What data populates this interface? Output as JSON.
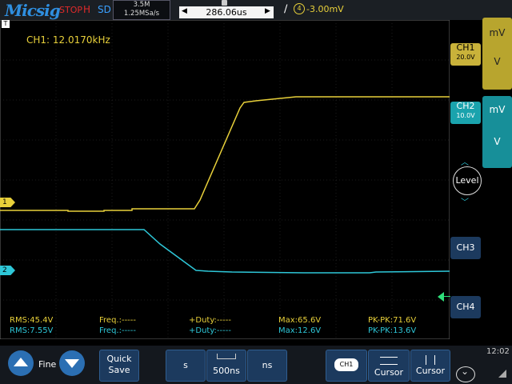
{
  "header": {
    "brand": "Micsig",
    "run_state": "STOP",
    "acq_mode": "H",
    "storage_mode": "SD",
    "memory_depth": "3.5M",
    "sample_rate": "1.25MSa/s",
    "time_position": "286.06us",
    "trigger_source": "4",
    "trigger_level": "-3.00mV"
  },
  "display": {
    "frequency_readout": "CH1: 12.0170kHz",
    "ch1_marker": "1",
    "ch2_marker": "2",
    "trigger_marker_label": "T"
  },
  "measurements": {
    "row1": {
      "rms": "RMS:45.4V",
      "freq": "Freq.:-----",
      "duty": "+Duty:-----",
      "max": "Max:65.6V",
      "pkpk": "PK-PK:71.6V"
    },
    "row2": {
      "rms": "RMS:7.55V",
      "freq": "Freq.:-----",
      "duty": "+Duty:-----",
      "max": "Max:12.6V",
      "pkpk": "PK-PK:13.6V"
    }
  },
  "channels": {
    "ch1": {
      "label": "CH1",
      "scale": "20.0V",
      "color": "#e8d03a"
    },
    "ch2": {
      "label": "CH2",
      "scale": "10.0V",
      "color": "#2ec7d8"
    },
    "ch3": {
      "label": "CH3"
    },
    "ch4": {
      "label": "CH4"
    }
  },
  "side_panels": {
    "ch1_unit_top": "mV",
    "ch1_unit_bottom": "V",
    "ch2_unit_top": "mV",
    "ch2_unit_bottom": "V",
    "level_label": "Level"
  },
  "bottom": {
    "fine_label": "Fine",
    "quick_save_line1": "Quick",
    "quick_save_line2": "Save",
    "timebase_left": "s",
    "timebase_value": "500ns",
    "timebase_right": "ns",
    "ch1_small": "CH1",
    "cursor1": "Cursor",
    "cursor2": "Cursor",
    "clock": "12:02"
  },
  "icons": [
    "up-arrow-icon",
    "down-arrow-icon",
    "cursor-horizontal-icon",
    "cursor-vertical-icon",
    "chevron-down-icon",
    "ruler-icon",
    "trigger-slope-icon"
  ]
}
